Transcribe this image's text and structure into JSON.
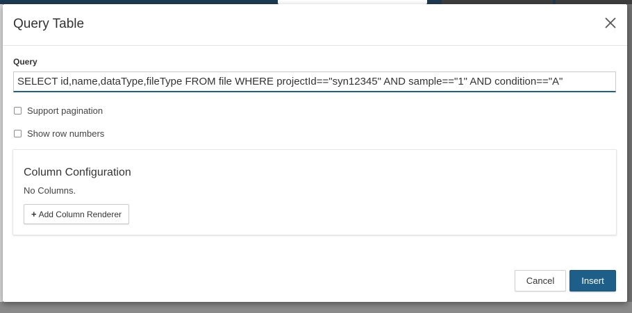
{
  "modal": {
    "title": "Query Table"
  },
  "query": {
    "label": "Query",
    "value": "SELECT id,name,dataType,fileType FROM file WHERE projectId==\"syn12345\" AND sample==\"1\" AND condition==\"A\""
  },
  "options": {
    "support_pagination": {
      "label": "Support pagination",
      "checked": false
    },
    "show_row_numbers": {
      "label": "Show row numbers",
      "checked": false
    }
  },
  "columns": {
    "title": "Column Configuration",
    "empty_text": "No Columns.",
    "add_label": "Add Column Renderer"
  },
  "footer": {
    "cancel_label": "Cancel",
    "insert_label": "Insert"
  },
  "icons": {
    "close": "close-icon",
    "plus": "plus-icon"
  },
  "colors": {
    "primary": "#1e5f8a",
    "background_header": "#1e3a52"
  }
}
